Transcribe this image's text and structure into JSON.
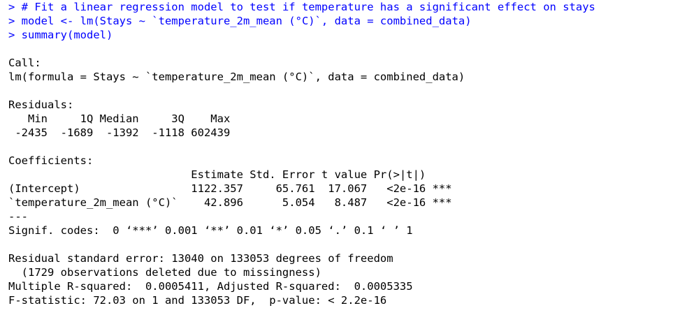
{
  "console": {
    "input_lines": [
      {
        "prompt": "> ",
        "code": "# Fit a linear regression model to test if temperature has a significant effect on stays"
      },
      {
        "prompt": "> ",
        "code": "model <- lm(Stays ~ `temperature_2m_mean (°C)`, data = combined_data)"
      },
      {
        "prompt": "> ",
        "code": "summary(model)"
      }
    ],
    "output": {
      "call_header": "Call:",
      "call_formula": "lm(formula = Stays ~ `temperature_2m_mean (°C)`, data = combined_data)",
      "residuals_header": "Residuals:",
      "residuals_labels": "   Min     1Q Median     3Q    Max ",
      "residuals_values": " -2435  -1689  -1392  -1118 602439 ",
      "coefficients_header": "Coefficients:",
      "coef_col_header": "                            Estimate Std. Error t value Pr(>|t|)    ",
      "coef_row_intercept": "(Intercept)                 1122.357     65.761  17.067   <2e-16 ***",
      "coef_row_temperature": "`temperature_2m_mean (°C)`    42.896      5.054   8.487   <2e-16 ***",
      "separator": "---",
      "signif_codes": "Signif. codes:  0 ‘***’ 0.001 ‘**’ 0.01 ‘*’ 0.05 ‘.’ 0.1 ‘ ’ 1",
      "residual_se": "Residual standard error: 13040 on 133053 degrees of freedom",
      "missingness": "  (1729 observations deleted due to missingness)",
      "r_squared": "Multiple R-squared:  0.0005411,\tAdjusted R-squared:  0.0005335 ",
      "f_statistic": "F-statistic: 72.03 on 1 and 133053 DF,  p-value: < 2.2e-16"
    }
  },
  "colors": {
    "input_text": "#0000ff",
    "output_text": "#000000",
    "background": "#ffffff"
  }
}
